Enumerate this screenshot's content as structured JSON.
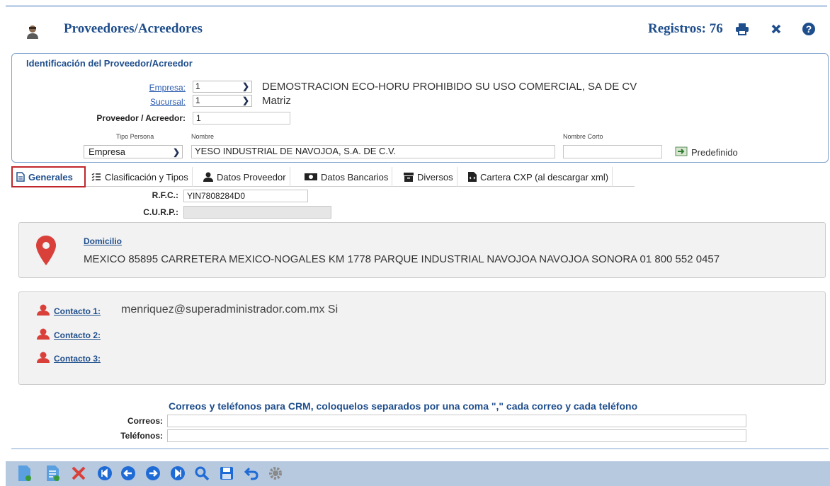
{
  "header": {
    "title": "Proveedores/Acreedores",
    "registros": "Registros: 76"
  },
  "ident": {
    "legend": "Identificación del Proveedor/Acreedor",
    "empresa_label": "Empresa:",
    "empresa_value": "1",
    "empresa_name": "DEMOSTRACION ECO-HORU PROHIBIDO SU USO COMERCIAL, SA DE CV",
    "sucursal_label": "Sucursal:",
    "sucursal_value": "1",
    "sucursal_name": "Matriz",
    "proveedor_label": "Proveedor / Acreedor:",
    "proveedor_value": "1",
    "tipo_persona_label": "Tipo Persona",
    "tipo_persona_value": "Empresa",
    "nombre_label": "Nombre",
    "nombre_value": "YESO INDUSTRIAL DE NAVOJOA, S.A. DE C.V.",
    "nombre_corto_label": "Nombre Corto",
    "nombre_corto_value": "",
    "predefinido": "Predefinido"
  },
  "tabs": [
    {
      "label": "Generales"
    },
    {
      "label": "Clasificación y Tipos"
    },
    {
      "label": "Datos Proveedor"
    },
    {
      "label": "Datos Bancarios"
    },
    {
      "label": "Diversos"
    },
    {
      "label": "Cartera CXP (al descargar xml)"
    }
  ],
  "generales": {
    "rfc_label": "R.F.C.:",
    "rfc_value": "YIN7808284D0",
    "curp_label": "C.U.R.P.:",
    "curp_value": "",
    "domicilio_label": "Domicilio",
    "domicilio_value": "MEXICO 85895 CARRETERA MEXICO-NOGALES KM 1778 PARQUE INDUSTRIAL NAVOJOA NAVOJOA SONORA 01 800 552 0457",
    "contactos": [
      {
        "label": "Contacto 1:",
        "value": "menriquez@superadministrador.com.mx Si"
      },
      {
        "label": "Contacto 2:",
        "value": ""
      },
      {
        "label": "Contacto 3:",
        "value": ""
      }
    ],
    "crm_title": "Correos y teléfonos para CRM, coloquelos separados por una coma \",\" cada correo y cada teléfono",
    "correos_label": "Correos:",
    "correos_value": "",
    "telefonos_label": "Teléfonos:",
    "telefonos_value": ""
  },
  "colors": {
    "accent": "#1f4e8c",
    "active_tab_border": "#c0272d",
    "pin": "#d9403a",
    "bottom_bar": "#b7c9df"
  }
}
